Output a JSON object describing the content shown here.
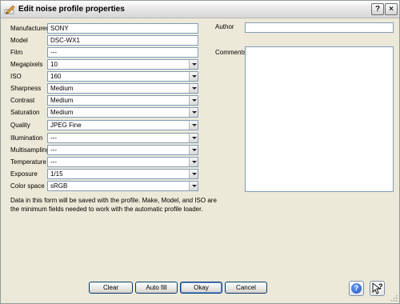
{
  "window": {
    "title": "Edit noise profile properties",
    "help_glyph": "?",
    "close_glyph": "×"
  },
  "form": {
    "manufacturer": {
      "label": "Manufacturer",
      "value": "SONY"
    },
    "model": {
      "label": "Model",
      "value": "DSC-WX1"
    },
    "film": {
      "label": "Film",
      "value": "---"
    },
    "megapixels": {
      "label": "Megapixels",
      "value": "10"
    },
    "iso": {
      "label": "ISO",
      "value": "160"
    },
    "sharpness": {
      "label": "Sharpness",
      "value": "Medium"
    },
    "contrast": {
      "label": "Contrast",
      "value": "Medium"
    },
    "saturation": {
      "label": "Saturation",
      "value": "Medium"
    },
    "quality": {
      "label": "Quality",
      "value": "JPEG Fine"
    },
    "illumination": {
      "label": "Illumination",
      "value": "---"
    },
    "multisampling": {
      "label": "Multisampling",
      "value": "---"
    },
    "temperature": {
      "label": "Temperature",
      "value": "---"
    },
    "exposure": {
      "label": "Exposure",
      "value": "1/15"
    },
    "color_space": {
      "label": "Color space",
      "value": "sRGB"
    }
  },
  "author": {
    "label": "Author",
    "value": ""
  },
  "comments": {
    "label": "Comments",
    "value": ""
  },
  "info": {
    "line1": "Data in this form will be saved with the profile. Make, Model, and ISO are",
    "line2": "the minimum fields needed to work with the automatic profile loader."
  },
  "buttons": {
    "clear": "Clear",
    "auto_fill": "Auto fill",
    "okay": "Okay",
    "cancel": "Cancel"
  },
  "icons": {
    "help": "help-icon",
    "whats_this": "whats-this-icon",
    "help_glyph": "?"
  }
}
